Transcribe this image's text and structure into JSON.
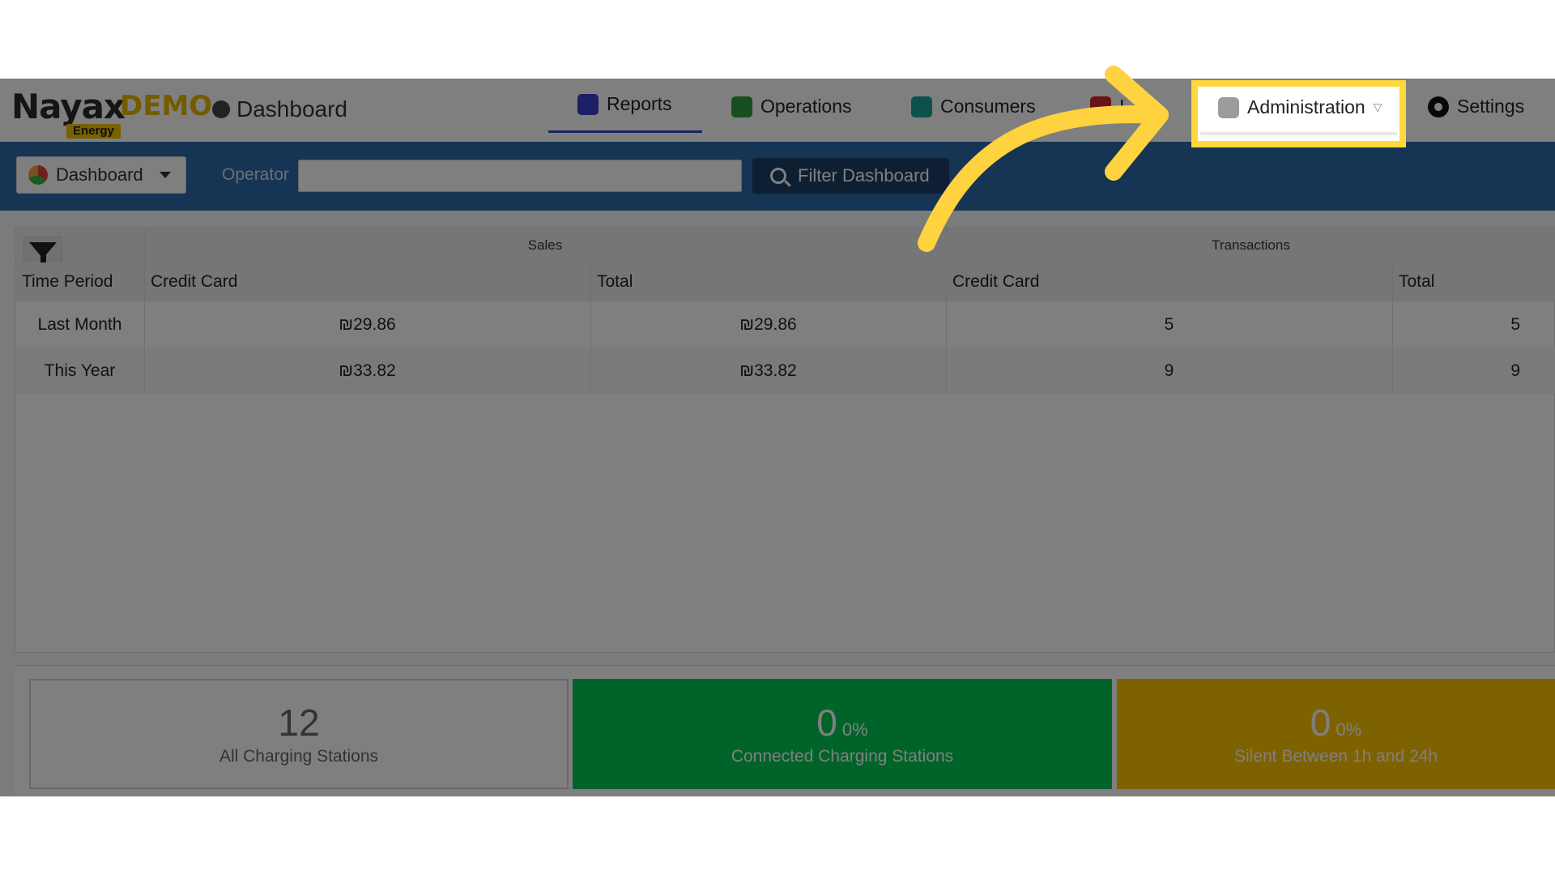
{
  "header": {
    "logo_main": "Nayax",
    "logo_demo": "DEMO",
    "logo_sub": "Energy",
    "breadcrumb": "Dashboard",
    "nav": {
      "reports": "Reports",
      "operations": "Operations",
      "consumers": "Consumers",
      "partial": "I",
      "administration": "Administration",
      "settings": "Settings"
    }
  },
  "filterbar": {
    "dashboard_select": "Dashboard",
    "operator_label": "Operator",
    "operator_value": "",
    "filter_button": "Filter Dashboard"
  },
  "table": {
    "group_sales": "Sales",
    "group_transactions": "Transactions",
    "columns": [
      "Time Period",
      "Credit Card",
      "Total",
      "Credit Card",
      "Total"
    ],
    "rows": [
      {
        "period": "Last Month",
        "sales_cc": "₪29.86",
        "sales_total": "₪29.86",
        "tx_cc": "5",
        "tx_total": "5"
      },
      {
        "period": "This Year",
        "sales_cc": "₪33.82",
        "sales_total": "₪33.82",
        "tx_cc": "9",
        "tx_total": "9"
      }
    ]
  },
  "stats": [
    {
      "value": "12",
      "pct": "",
      "label": "All Charging Stations",
      "color": "#ffffff"
    },
    {
      "value": "0",
      "pct": "0%",
      "label": "Connected Charging Stations",
      "color": "#00c853"
    },
    {
      "value": "0",
      "pct": "0%",
      "label": "Silent Between 1h and 24h",
      "color": "#ffc400"
    }
  ],
  "annotation": {
    "highlight_color": "#ffd93b",
    "arrow_color": "#ffd23f"
  }
}
